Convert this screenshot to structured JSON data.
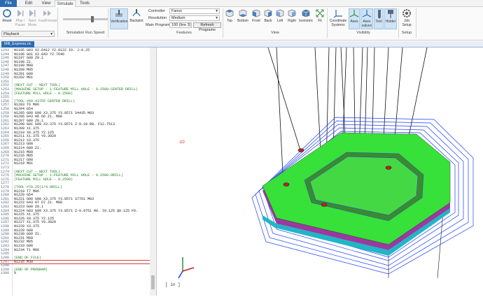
{
  "tabs": [
    "File",
    "Edit",
    "View",
    "Simulate",
    "Tools"
  ],
  "active_tab": "Simulate",
  "ribbon": {
    "playback": {
      "buttons": [
        "Reset",
        "Play / Pause",
        "Next Move",
        "FastForward"
      ],
      "group_label": "Playback"
    },
    "run_speed": {
      "group_label": "Simulation Run Speed"
    },
    "verification": {
      "verification_label": "Verification",
      "backplot_label": "Backplot"
    },
    "features": {
      "controller_label": "Controller",
      "controller_value": "Fanuc",
      "resolution_label": "Resolution",
      "resolution_value": "Medium",
      "main_program_label": "Main Program",
      "main_program_value": "100 (line 3)",
      "refresh_label": "Refresh Programs",
      "group_label": "Features"
    },
    "view": {
      "buttons": [
        "Top",
        "Bottom",
        "Front",
        "Back",
        "Left",
        "Right",
        "Isometric",
        "Fit"
      ],
      "group_label": "View"
    },
    "visibility": {
      "buttons": [
        "Coordinate Systems",
        "Axes",
        "Axes values",
        "Tool",
        "Holder"
      ],
      "group_label": "Visibility"
    },
    "setup": {
      "buttons": [
        "Job Setup"
      ],
      "group_label": "Setup"
    }
  },
  "doc_tab": "Mill_Express.nc",
  "viewport": {
    "axis_value": "-10",
    "unit_label": "[ in ]"
  },
  "colors": {
    "accent": "#2b6bb3",
    "part_green": "#38e03a",
    "part_magenta": "#9a3aa0",
    "toolpath_blue": "#1a3ff0",
    "part_teal": "#1fb6c6"
  },
  "code_lines": [
    [
      "1243",
      "N1195 G03 X2.6412 Y2.9122 I0. J-0.25"
    ],
    [
      "1244",
      "N1196 G01 X2.843 Y2.7646"
    ],
    [
      "1245",
      "N1197 G00 Z0.1"
    ],
    [
      "1246",
      "N1198 Z1."
    ],
    [
      "1247",
      "N1199 M09"
    ],
    [
      "1248",
      "N1200 M05"
    ],
    [
      "1249",
      "N1201 G90"
    ],
    [
      "1250",
      "N1202 M01"
    ],
    [
      "1251",
      ""
    ],
    [
      "1252",
      "(NEXT CUT - NEXT TOOL)"
    ],
    [
      "1253",
      "(MACHINE SETUP - 1-FEATURE MILL HOLE - 0.2500-CENTER DRILL)"
    ],
    [
      "1254",
      "(FEATURE MILL HOLE - 0.2500)"
    ],
    [
      "1255",
      ""
    ],
    [
      "1256",
      "(TOOL #60.43755 CENTER DRILL)"
    ],
    [
      "1257",
      "N1203 T6 M06"
    ],
    [
      "1258",
      "N1204 G54"
    ],
    [
      "1259",
      "N1205 G00 G90 X3.375 Y3.8571 S4435 M03"
    ],
    [
      "1260",
      "N1206 G43 H6 D6 Z1. M08"
    ],
    [
      "1261",
      "N1207 G00 Z0.1"
    ],
    [
      "1262",
      "N1208 G81 G99 X3.375 Y3.8571 Z-0.18 R0. F12.7513"
    ],
    [
      "1263",
      "N1209 X1.375"
    ],
    [
      "1264",
      "N1210 X0.375 Y2.125"
    ],
    [
      "1265",
      "N1211 X1.375 Y0.3929"
    ],
    [
      "1266",
      "N1212 X3.375"
    ],
    [
      "1267",
      "N1213 G80"
    ],
    [
      "1268",
      "N1214 G00 Z1."
    ],
    [
      "1269",
      "N1215 M09"
    ],
    [
      "1270",
      "N1216 M05"
    ],
    [
      "1271",
      "N1217 G90"
    ],
    [
      "1272",
      "N1218 M01"
    ],
    [
      "1273",
      ""
    ],
    [
      "1274",
      "(NEXT CUT - NEXT TOOL)"
    ],
    [
      "1275",
      "(MACHINE SETUP - 1-FEATURE MILL HOLE - 0.2500-DRILL)"
    ],
    [
      "1276",
      "(FEATURE MILL HOLE - 0.2500)"
    ],
    [
      "1277",
      ""
    ],
    [
      "1278",
      "(TOOL #70.25(1/4 DRILL)"
    ],
    [
      "1279",
      "N1219 T7 M06"
    ],
    [
      "1280",
      "N1220 G54"
    ],
    [
      "1281",
      "N1221 G00 G90 X3.375 Y3.8571 S7761 M03"
    ],
    [
      "1282",
      "N1222 G43 H7 D7 Z1. M08"
    ],
    [
      "1283",
      "N1223 G00 Z0.1"
    ],
    [
      "1284",
      "N1224 G83 G99 X3.375 Y3.8571 Z-0.9751 R0. I0.125 Q0.125 F0."
    ],
    [
      "1285",
      "N1225 X1.375"
    ],
    [
      "1286",
      "N1226 X0.375 Y2.125"
    ],
    [
      "1287",
      "N1227 X1.375 Y0.3929"
    ],
    [
      "1288",
      "N1228 X3.375"
    ],
    [
      "1289",
      "N1229 G80"
    ],
    [
      "1290",
      "N1230 G00 Z1."
    ],
    [
      "1291",
      "N1231 M09"
    ],
    [
      "1292",
      "N1232 M05"
    ],
    [
      "1293",
      "N1233 G90"
    ],
    [
      "1294",
      "N1234 T1 M06"
    ],
    [
      "1295",
      ""
    ],
    [
      "1296",
      "(END OF FILE)"
    ],
    [
      "1297",
      "N1235 M30"
    ],
    [
      "1298",
      ""
    ],
    [
      "1299",
      "(END OF PROGRAM)"
    ],
    [
      "1300",
      "%"
    ]
  ]
}
